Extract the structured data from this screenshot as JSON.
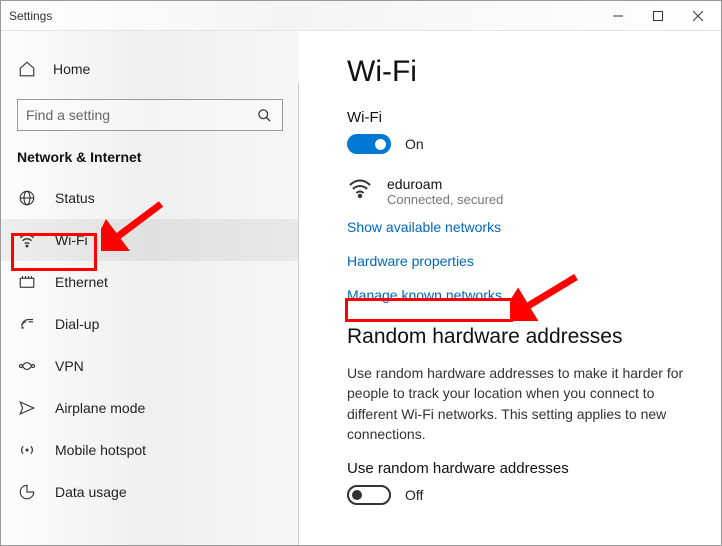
{
  "window": {
    "title": "Settings"
  },
  "sidebar": {
    "home": "Home",
    "search_placeholder": "Find a setting",
    "section": "Network & Internet",
    "items": [
      {
        "label": "Status"
      },
      {
        "label": "Wi-Fi"
      },
      {
        "label": "Ethernet"
      },
      {
        "label": "Dial-up"
      },
      {
        "label": "VPN"
      },
      {
        "label": "Airplane mode"
      },
      {
        "label": "Mobile hotspot"
      },
      {
        "label": "Data usage"
      }
    ]
  },
  "main": {
    "title": "Wi-Fi",
    "wifi_label": "Wi-Fi",
    "wifi_toggle_state": "On",
    "network": {
      "name": "eduroam",
      "status": "Connected, secured"
    },
    "links": {
      "show_networks": "Show available networks",
      "hardware": "Hardware properties",
      "manage": "Manage known networks"
    },
    "random": {
      "heading": "Random hardware addresses",
      "body": "Use random hardware addresses to make it harder for people to track your location when you connect to different Wi-Fi networks. This setting applies to new connections.",
      "toggle_label": "Use random hardware addresses",
      "toggle_state": "Off"
    }
  }
}
